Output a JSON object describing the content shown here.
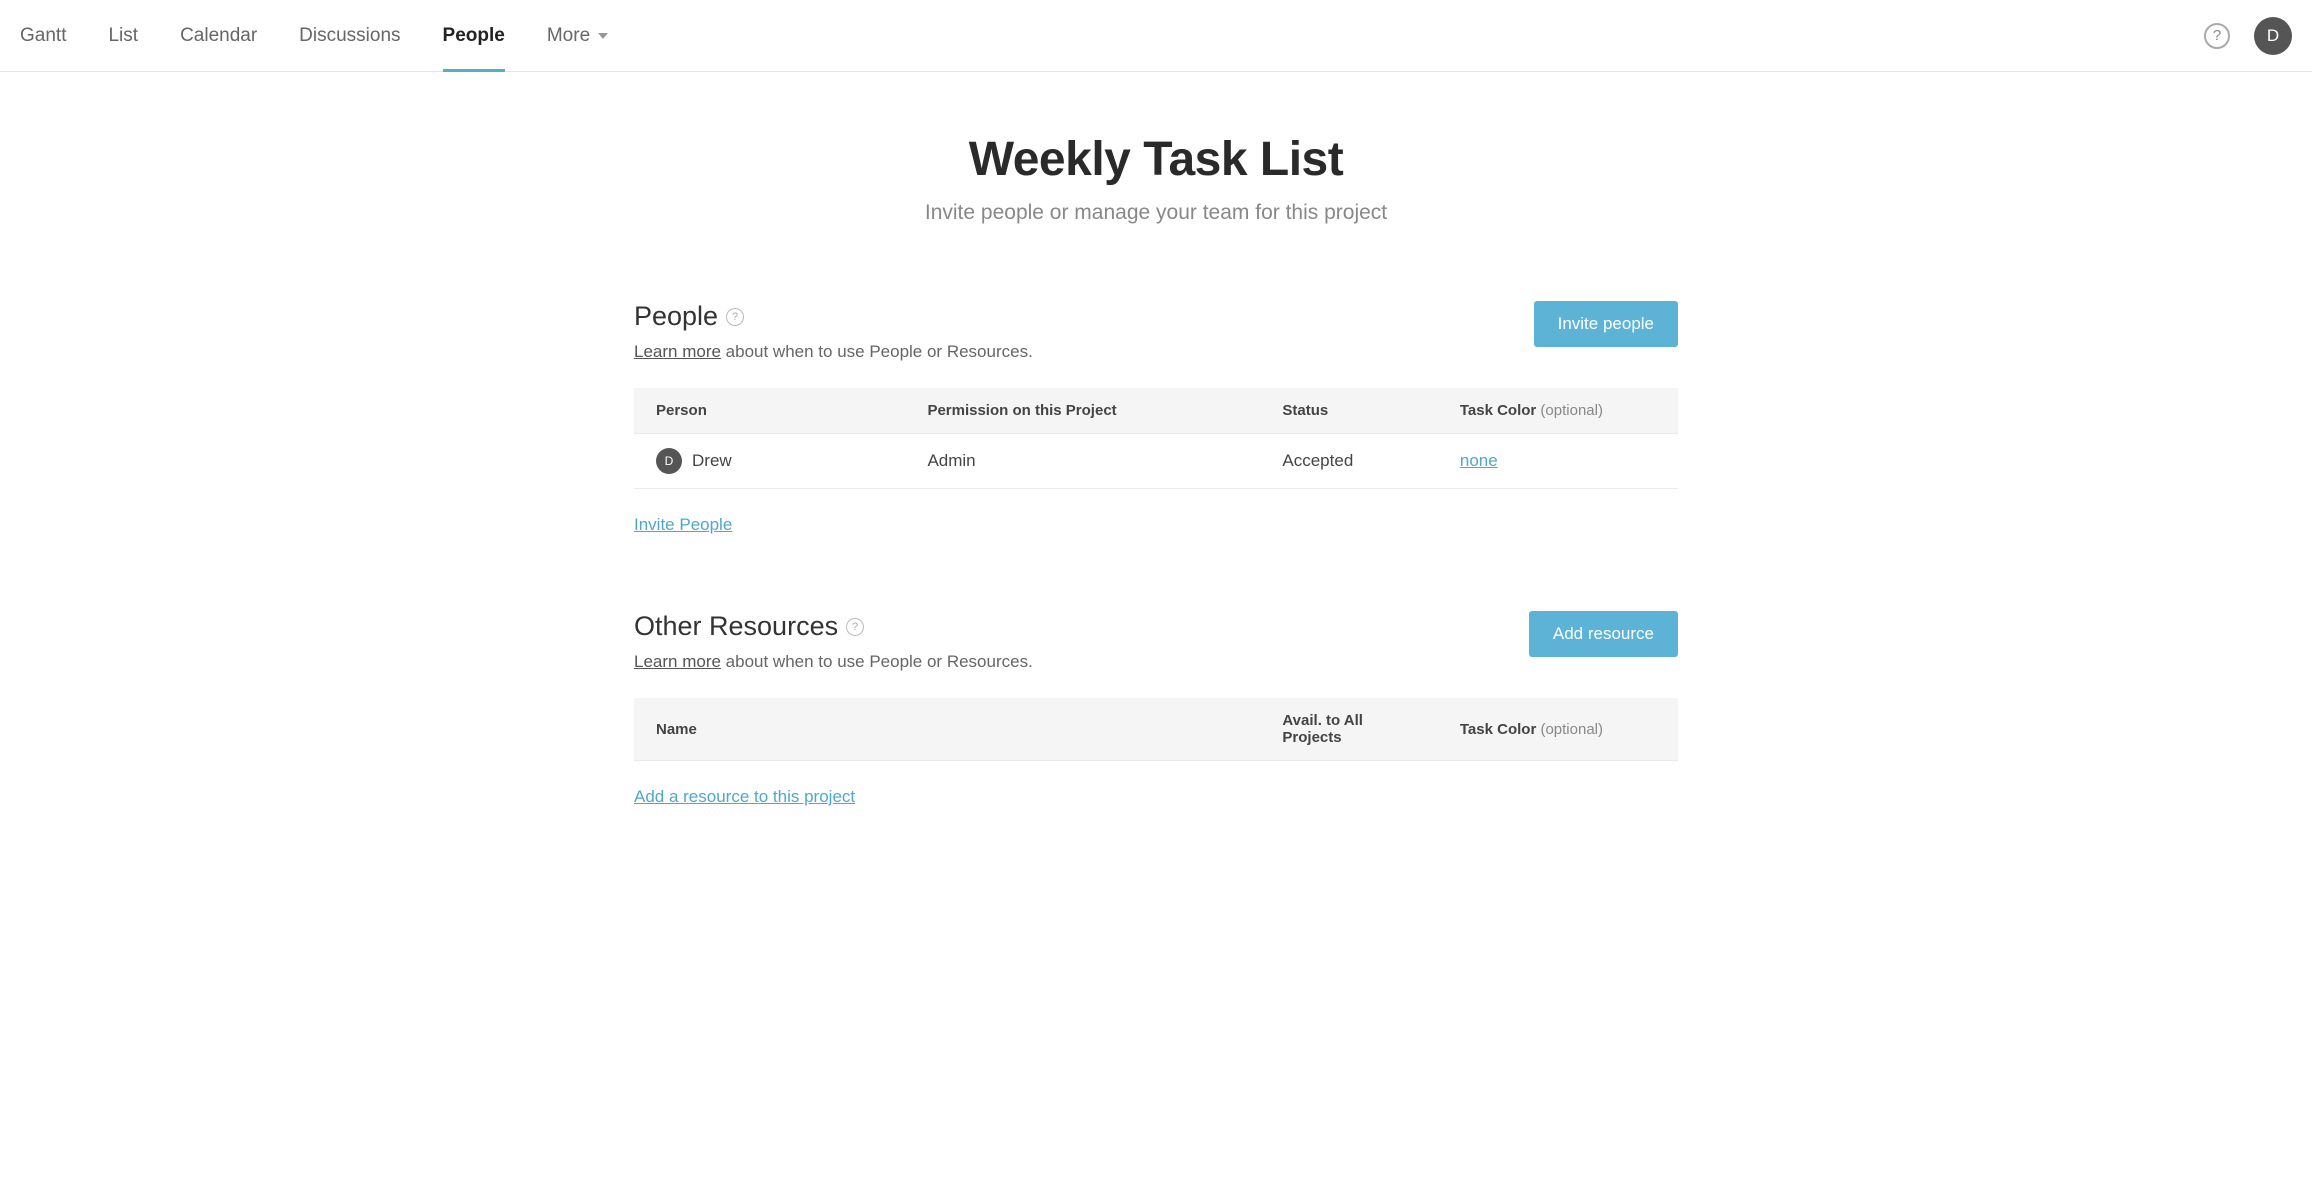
{
  "nav": {
    "tabs": [
      "Gantt",
      "List",
      "Calendar",
      "Discussions",
      "People"
    ],
    "more_label": "More",
    "active_index": 4
  },
  "header": {
    "avatar_initial": "D"
  },
  "page": {
    "title": "Weekly Task List",
    "subtitle": "Invite people or manage your team for this project"
  },
  "people_section": {
    "title": "People",
    "learn_more_label": "Learn more",
    "hint_text": " about when to use People or Resources.",
    "invite_button": "Invite people",
    "columns": {
      "person": "Person",
      "permission": "Permission on this Project",
      "status": "Status",
      "task_color": "Task Color",
      "optional": " (optional)"
    },
    "rows": [
      {
        "avatar_initial": "D",
        "name": "Drew",
        "permission": "Admin",
        "status": "Accepted",
        "task_color": "none"
      }
    ],
    "footer_link": "Invite People"
  },
  "resources_section": {
    "title": "Other Resources",
    "learn_more_label": "Learn more",
    "hint_text": " about when to use People or Resources.",
    "add_button": "Add resource",
    "columns": {
      "name": "Name",
      "avail": "Avail. to All Projects",
      "task_color": "Task Color",
      "optional": " (optional)"
    },
    "footer_link": "Add a resource to this project"
  }
}
